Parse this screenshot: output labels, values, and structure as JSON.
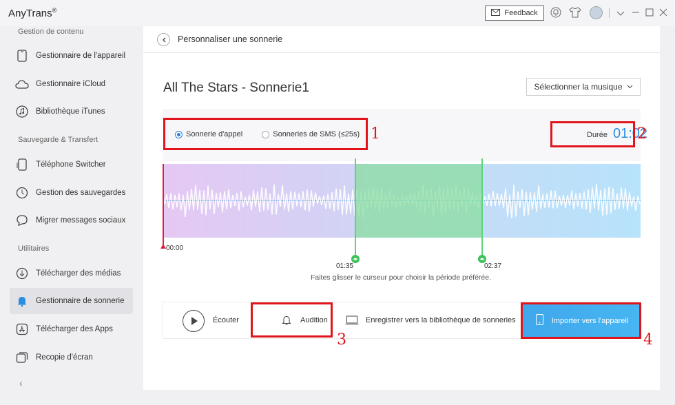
{
  "app": {
    "title": "AnyTrans",
    "title_mark": "®",
    "feedback_label": "Feedback"
  },
  "sidebar": {
    "sections": [
      "Gestion de contenu",
      "Sauvegarde & Transfert",
      "Utilitaires"
    ],
    "items": [
      {
        "label": "Gestionnaire de l'appareil",
        "icon": "phone-icon"
      },
      {
        "label": "Gestionnaire iCloud",
        "icon": "cloud-icon"
      },
      {
        "label": "Bibliothèque iTunes",
        "icon": "music-note-icon"
      },
      {
        "label": "Téléphone Switcher",
        "icon": "phone-switch-icon"
      },
      {
        "label": "Gestion des sauvegardes",
        "icon": "history-icon"
      },
      {
        "label": "Migrer messages sociaux",
        "icon": "chat-icon"
      },
      {
        "label": "Télécharger des médias",
        "icon": "download-icon"
      },
      {
        "label": "Gestionnaire de sonnerie",
        "icon": "bell-icon",
        "active": true
      },
      {
        "label": "Télécharger des Apps",
        "icon": "app-store-icon"
      },
      {
        "label": "Recopie d'écran",
        "icon": "screen-mirror-icon"
      }
    ],
    "collapse_glyph": "‹"
  },
  "main": {
    "header_title": "Personnaliser une sonnerie",
    "song_title": "All The Stars - Sonnerie1",
    "select_music_label": "Sélectionner la musique",
    "ringtone_types": [
      {
        "label": "Sonnerie d'appel",
        "selected": true
      },
      {
        "label": "Sonneries de SMS (≤25s)",
        "selected": false
      }
    ],
    "duration_label": "Durée",
    "duration_value": "01:02",
    "waveform": {
      "start_time": "00:00",
      "selection_start": "01:35",
      "selection_end": "02:37"
    },
    "hint": "Faites glisser le curseur pour choisir la période préférée.",
    "actions": {
      "listen_label": "Écouter",
      "preview_label": "Audition",
      "save_label": "Enregistrer vers la bibliothèque de sonneries",
      "import_label": "Importer vers l'appareil"
    }
  },
  "annotations": [
    "1",
    "2",
    "3",
    "4"
  ],
  "colors": {
    "accent": "#2b8fe0",
    "import_button": "#42adf0",
    "annotation": "#e0141a",
    "selection": "#88dea0",
    "playhead": "#e21b3b"
  }
}
